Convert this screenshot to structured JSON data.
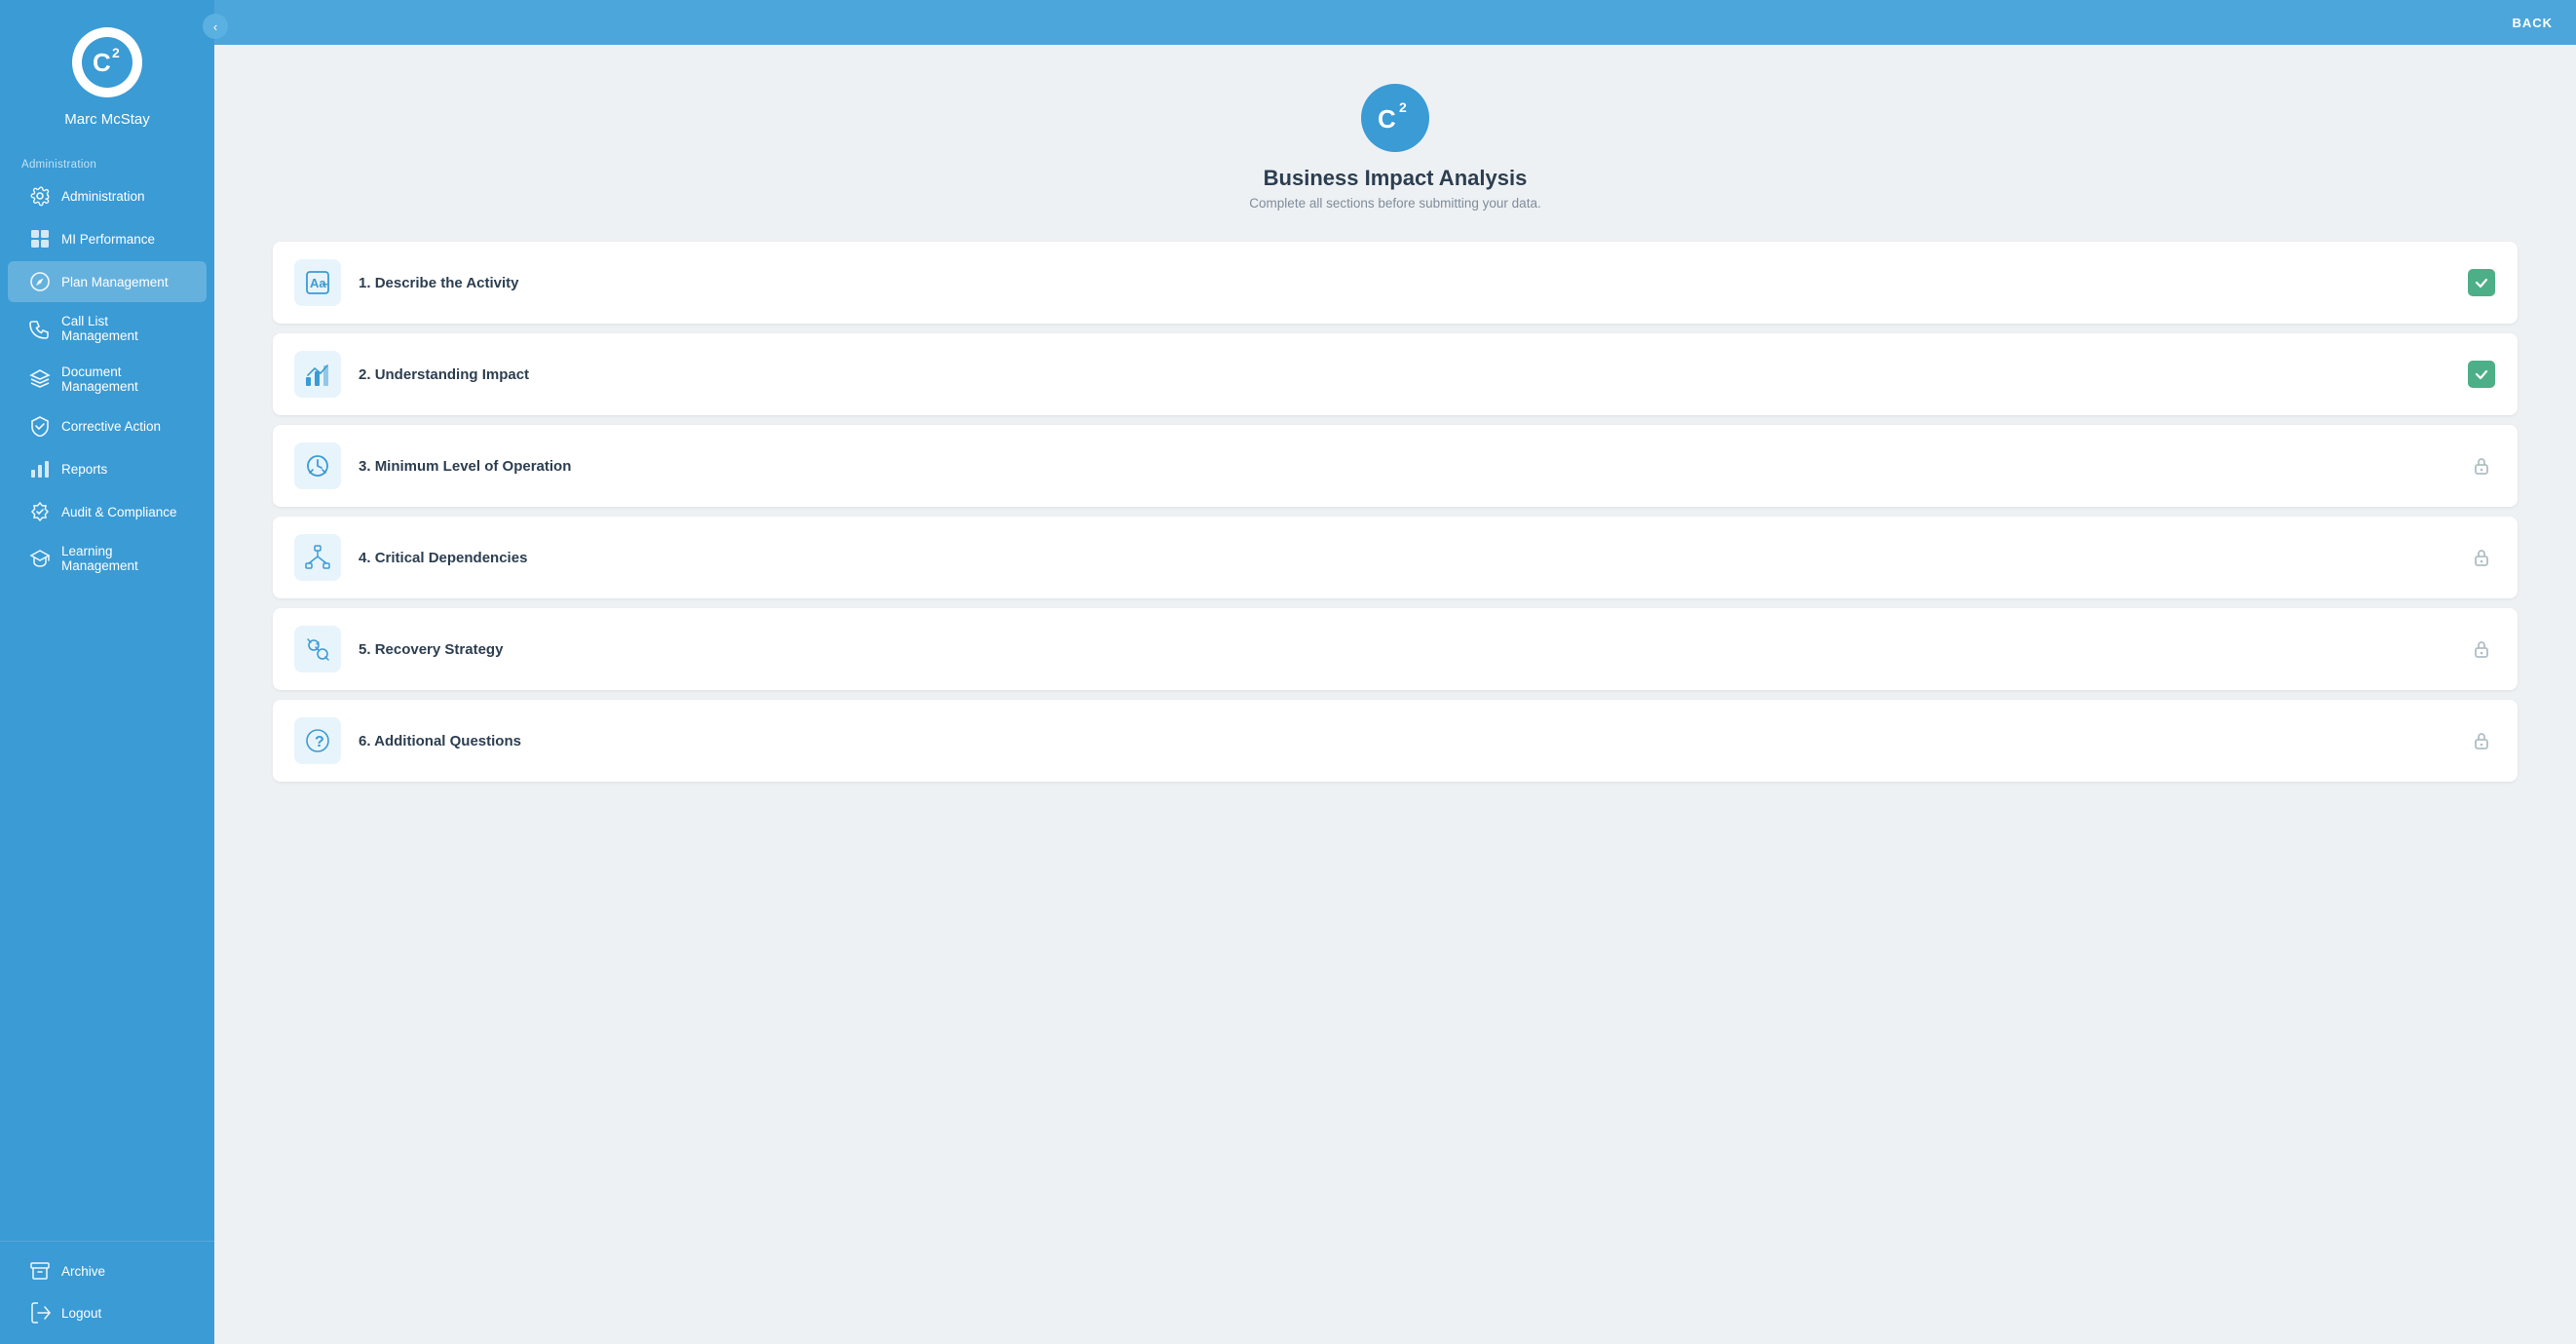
{
  "sidebar": {
    "logo_alt": "C2 Logo",
    "user_name": "Marc McStay",
    "section_label": "Administration",
    "items": [
      {
        "id": "administration",
        "label": "Administration",
        "icon": "gear"
      },
      {
        "id": "mi-performance",
        "label": "MI Performance",
        "icon": "dashboard"
      },
      {
        "id": "plan-management",
        "label": "Plan Management",
        "icon": "compass",
        "active": true
      },
      {
        "id": "call-list-management",
        "label": "Call List Management",
        "icon": "phone"
      },
      {
        "id": "document-management",
        "label": "Document Management",
        "icon": "layers"
      },
      {
        "id": "corrective-action",
        "label": "Corrective Action",
        "icon": "shield"
      },
      {
        "id": "reports",
        "label": "Reports",
        "icon": "bar-chart"
      },
      {
        "id": "audit-compliance",
        "label": "Audit & Compliance",
        "icon": "check-badge"
      },
      {
        "id": "learning-management",
        "label": "Learning Management",
        "icon": "graduation"
      }
    ],
    "bottom_items": [
      {
        "id": "archive",
        "label": "Archive",
        "icon": "archive"
      },
      {
        "id": "logout",
        "label": "Logout",
        "icon": "logout"
      }
    ],
    "collapse_icon": "‹"
  },
  "topbar": {
    "back_label": "BACK"
  },
  "page": {
    "title": "Business Impact Analysis",
    "subtitle": "Complete all sections before submitting your data.",
    "sections": [
      {
        "id": "describe-activity",
        "number": "1.",
        "label": "Describe the Activity",
        "icon": "text",
        "status": "complete"
      },
      {
        "id": "understanding-impact",
        "number": "2.",
        "label": "Understanding Impact",
        "icon": "chart-bar",
        "status": "complete"
      },
      {
        "id": "minimum-level",
        "number": "3.",
        "label": "Minimum Level of Operation",
        "icon": "gauge",
        "status": "locked"
      },
      {
        "id": "critical-dependencies",
        "number": "4.",
        "label": "Critical Dependencies",
        "icon": "org-chart",
        "status": "locked"
      },
      {
        "id": "recovery-strategy",
        "number": "5.",
        "label": "Recovery Strategy",
        "icon": "tools",
        "status": "locked"
      },
      {
        "id": "additional-questions",
        "number": "6.",
        "label": "Additional Questions",
        "icon": "question",
        "status": "locked"
      }
    ]
  }
}
